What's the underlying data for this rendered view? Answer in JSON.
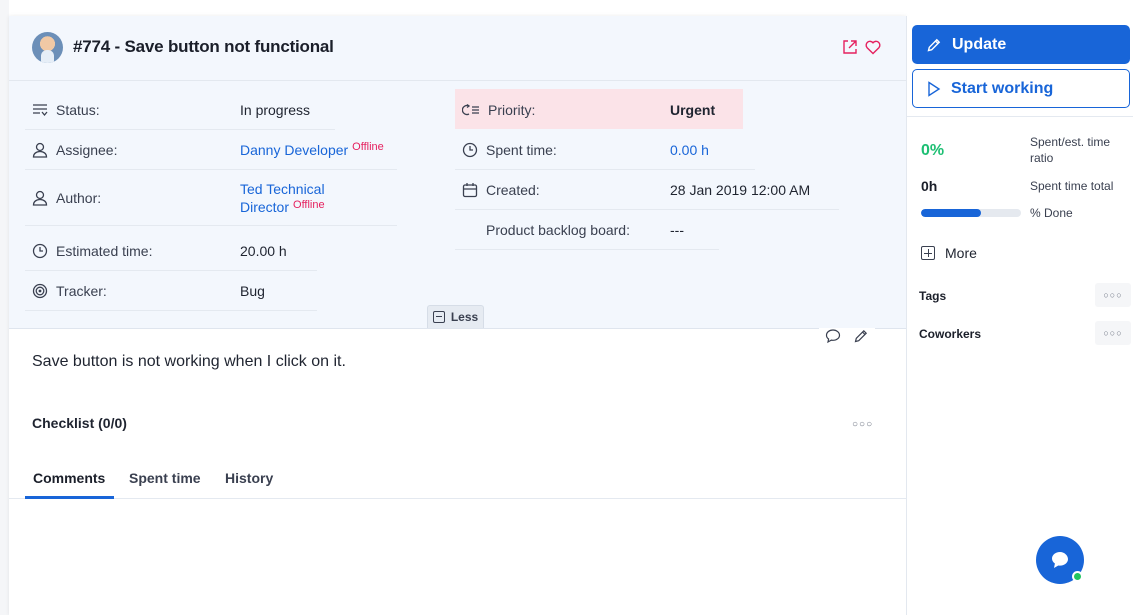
{
  "issue": {
    "title": "#774 - Save button not functional"
  },
  "attributes": {
    "status": {
      "label": "Status:",
      "value": "In progress"
    },
    "assignee": {
      "label": "Assignee:",
      "value": "Danny Developer",
      "presence": "Offline"
    },
    "author": {
      "label": "Author:",
      "value_line1": "Ted Technical",
      "value_line2": "Director",
      "presence": "Offline"
    },
    "estimated_time": {
      "label": "Estimated time:",
      "value": "20.00 h"
    },
    "tracker": {
      "label": "Tracker:",
      "value": "Bug"
    },
    "priority": {
      "label": "Priority:",
      "value": "Urgent",
      "highlight_color": "#fbe3e8"
    },
    "spent_time": {
      "label": "Spent time:",
      "value": "0.00 h"
    },
    "created": {
      "label": "Created:",
      "value": "28 Jan 2019 12:00 AM"
    },
    "product_backlog_board": {
      "label": "Product backlog board:",
      "value": "---"
    },
    "less_label": "Less"
  },
  "description": "Save button is not working when I click on it.",
  "checklist": {
    "label": "Checklist (0/0)"
  },
  "tabs": [
    {
      "label": "Comments",
      "active": true
    },
    {
      "label": "Spent time",
      "active": false
    },
    {
      "label": "History",
      "active": false
    }
  ],
  "sidebar": {
    "update_label": "Update",
    "start_label": "Start working",
    "ratio_value": "0%",
    "ratio_label": "Spent/est. time ratio",
    "total_value": "0h",
    "total_label": "Spent time total",
    "done_percent": 0.6,
    "done_label": "% Done",
    "more_label": "More",
    "tags_label": "Tags",
    "coworkers_label": "Coworkers"
  },
  "colors": {
    "accent": "#1865d8",
    "offline": "#e5215f",
    "ratio_green": "#1dbf73"
  },
  "icons": [
    "status-icon",
    "user-icon",
    "clock-icon",
    "tracker-icon",
    "priority-icon",
    "calendar-icon",
    "external-link-icon",
    "heart-icon",
    "comment-icon",
    "pencil-icon",
    "play-icon",
    "chat-icon"
  ]
}
